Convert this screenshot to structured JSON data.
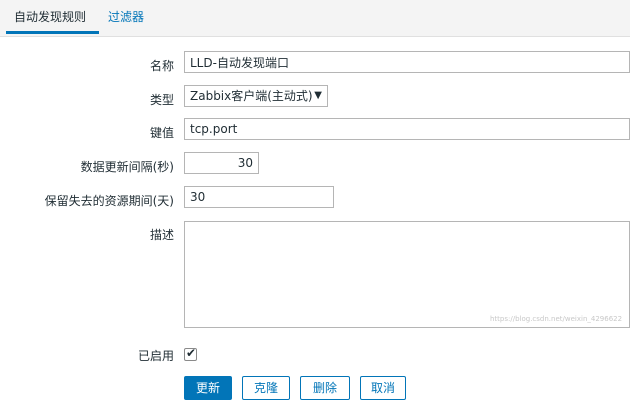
{
  "tabs": [
    {
      "label": "自动发现规则",
      "active": true
    },
    {
      "label": "过滤器",
      "active": false
    }
  ],
  "form": {
    "name": {
      "label": "名称",
      "value": "LLD-自动发现端口"
    },
    "type": {
      "label": "类型",
      "value": "Zabbix客户端(主动式)"
    },
    "key": {
      "label": "键值",
      "value": "tcp.port"
    },
    "interval": {
      "label": "数据更新间隔(秒)",
      "value": "30"
    },
    "lifetime": {
      "label": "保留失去的资源期间(天)",
      "value": "30"
    },
    "description": {
      "label": "描述",
      "value": ""
    },
    "enabled": {
      "label": "已启用",
      "checked": true
    }
  },
  "buttons": {
    "update": "更新",
    "clone": "克隆",
    "delete": "删除",
    "cancel": "取消"
  },
  "watermark": "https://blog.csdn.net/weixin_4296622",
  "colors": {
    "accent": "#0275b8",
    "border": "#b5b5b5"
  }
}
